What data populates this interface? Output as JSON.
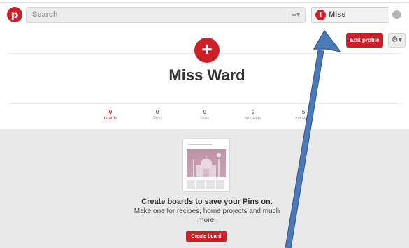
{
  "header": {
    "search_placeholder": "Search",
    "user_name": "Miss",
    "logo_icon": "pinterest-logo-icon",
    "brand_color": "#cb2027"
  },
  "profile": {
    "name": "Miss Ward",
    "edit_label": "Edit profile",
    "stats": [
      {
        "value": "0",
        "label": "boards"
      },
      {
        "value": "0",
        "label": "Pins"
      },
      {
        "value": "0",
        "label": "likes"
      },
      {
        "value": "0",
        "label": "followers"
      },
      {
        "value": "5",
        "label": "following"
      }
    ]
  },
  "empty_state": {
    "title": "Create boards to save your Pins on.",
    "description": "Make one for recipes, home projects and much more!",
    "button_label": "Create board"
  },
  "annotation": {
    "arrow_color": "#4a7ab8"
  }
}
